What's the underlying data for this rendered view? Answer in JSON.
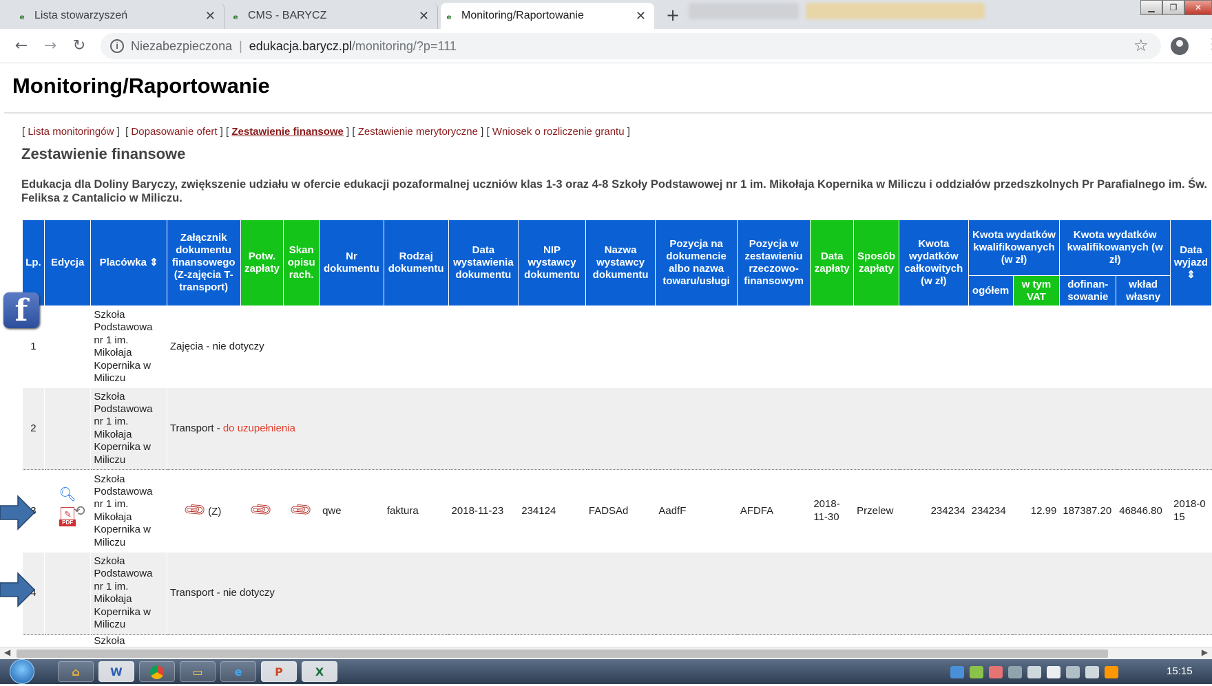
{
  "browser": {
    "tabs": [
      {
        "title": "Lista stowarzyszeń",
        "active": false
      },
      {
        "title": "CMS - BARYCZ",
        "active": false
      },
      {
        "title": "Monitoring/Raportowanie",
        "active": true
      }
    ],
    "security_label": "Niezabezpieczona",
    "url_host": "edukacja.barycz.pl",
    "url_path": "/monitoring/?p=111"
  },
  "page": {
    "title": "Monitoring/Raportowanie",
    "subnav": [
      {
        "label": "Lista monitoringów",
        "current": false
      },
      {
        "label": "Dopasowanie ofert",
        "current": false
      },
      {
        "label": "Zestawienie finansowe",
        "current": true
      },
      {
        "label": "Zestawienie merytoryczne",
        "current": false
      },
      {
        "label": "Wniosek o rozliczenie grantu",
        "current": false
      }
    ],
    "section_title": "Zestawienie finansowe",
    "project_title": "Edukacja dla Doliny Baryczy, zwiększenie udziału w ofercie edukacji pozaformalnej uczniów klas 1-3 oraz 4-8 Szkoły Podstawowej nr 1 im. Mikołaja Kopernika w Miliczu i oddziałów przedszkolnych Pr Parafialnego im. Św. Feliksa z Cantalicio w Miliczu."
  },
  "table": {
    "headers": {
      "lp": "Lp.",
      "edycja": "Edycja",
      "placowka": "Placówka ⇕",
      "zalacznik": "Załącznik dokumentu finansowego (Z-zajęcia T-transport)",
      "potw": "Potw. zapłaty",
      "skan": "Skan opisu rach.",
      "nr": "Nr dokumentu",
      "rodzaj": "Rodzaj dokumentu",
      "data_wyst": "Data wystawienia dokumentu",
      "nip": "NIP wystawcy dokumentu",
      "nazwa": "Nazwa wystawcy dokumentu",
      "pozycja_dok": "Pozycja na dokumencie albo nazwa towaru/usługi",
      "pozycja_zest": "Pozycja w zestawieniu rzeczowo-finansowym",
      "data_zap": "Data zapłaty",
      "sposob": "Sposób zapłaty",
      "kwota_calk": "Kwota wydatków całkowitych (w zł)",
      "kwota_kwal": "Kwota wydatków kwalifikowanych (w zł)",
      "ogolem": "ogółem",
      "vat": "w tym VAT",
      "kwota_kwal2": "Kwota wydatków kwalifikowanych (w zł)",
      "dofinansowanie": "dofinan-sowanie",
      "wklad": "wkład własny",
      "data_wyjazdu": "Data wyjazd ⇕"
    },
    "rows": [
      {
        "lp": "1",
        "placowka": "Szkoła Podstawowa nr 1 im. Mikołaja Kopernika w Miliczu",
        "type": "Zajęcia",
        "status": "nie dotyczy"
      },
      {
        "lp": "2",
        "placowka": "Szkoła Podstawowa nr 1 im. Mikołaja Kopernika w Miliczu",
        "type": "Transport",
        "status": "do uzupełnienia"
      },
      {
        "lp": "3",
        "placowka": "Szkoła Podstawowa nr 1 im. Mikołaja Kopernika w Miliczu",
        "zal_tag": "(Z)",
        "nr": "qwe",
        "rodzaj": "faktura",
        "data_wyst": "2018-11-23",
        "nip": "234124",
        "nazwa": "FADSAd",
        "pozycja_dok": "AadfF",
        "pozycja_zest": "AFDFA",
        "data_zap": "2018-11-30",
        "sposob": "Przelew",
        "kwota_calk": "234234",
        "ogolem": "234234",
        "vat": "12.99",
        "dofinansowanie": "187387.20",
        "wklad": "46846.80",
        "data_wyjazdu": "2018-0 15"
      },
      {
        "lp": "4",
        "placowka": "Szkoła Podstawowa nr 1 im. Mikołaja Kopernika w Miliczu",
        "type": "Transport",
        "status": "nie dotyczy"
      },
      {
        "lp": "",
        "placowka": "Szkoła"
      }
    ]
  },
  "taskbar": {
    "clock": "15:15",
    "apps": [
      "W",
      "P",
      "X"
    ]
  },
  "colors": {
    "header_blue": "#0b61d4",
    "header_green": "#15c419",
    "link_red": "#8b1a1a",
    "status_red": "#e23b2a"
  }
}
